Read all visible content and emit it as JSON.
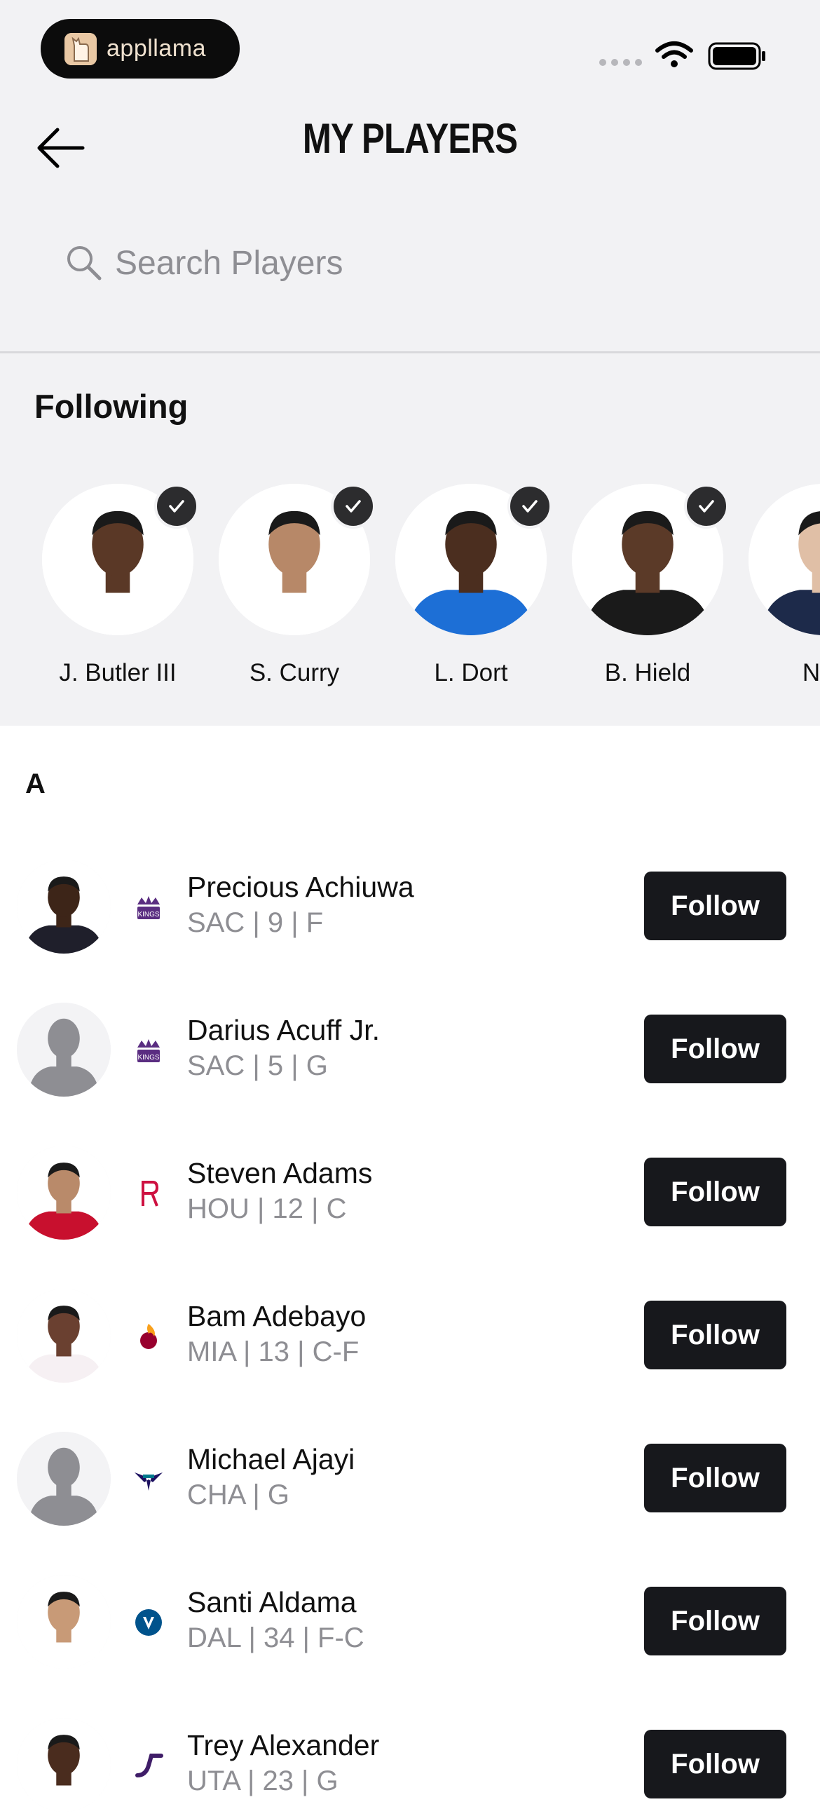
{
  "status_bar": {
    "app_badge": "appllama",
    "icons": [
      "signal-dots-icon",
      "wifi-icon",
      "battery-icon"
    ]
  },
  "header": {
    "back_icon": "arrow-left-icon",
    "title": "MY PLAYERS"
  },
  "search": {
    "placeholder": "Search Players",
    "value": ""
  },
  "following": {
    "label": "Following",
    "players": [
      {
        "name": "J. Butler III",
        "jersey": "#ffffff",
        "skin": "#5a3826",
        "followed": true
      },
      {
        "name": "S. Curry",
        "jersey": "#ffffff",
        "skin": "#b78868",
        "followed": true
      },
      {
        "name": "L. Dort",
        "jersey": "#1d6fd6",
        "skin": "#4b2e1f",
        "followed": true
      },
      {
        "name": "B. Hield",
        "jersey": "#1a1a1a",
        "skin": "#5b3a28",
        "followed": true
      },
      {
        "name": "N. J",
        "jersey": "#1d2a4a",
        "skin": "#e0bfa6",
        "followed": false
      }
    ]
  },
  "section_letter": "A",
  "players": [
    {
      "name": "Precious Achiuwa",
      "meta": "SAC | 9 | F",
      "team_icon": "kings-logo-icon",
      "team_color": "#5a2d81",
      "photo": "person",
      "jersey": "#1f1f2b",
      "skin": "#3d2518",
      "follow_label": "Follow"
    },
    {
      "name": "Darius Acuff Jr.",
      "meta": "SAC | 5 | G",
      "team_icon": "kings-logo-icon",
      "team_color": "#5a2d81",
      "photo": "placeholder",
      "jersey": "#8e8e93",
      "skin": "#8e8e93",
      "follow_label": "Follow"
    },
    {
      "name": "Steven Adams",
      "meta": "HOU | 12 | C",
      "team_icon": "rockets-logo-icon",
      "team_color": "#ce1141",
      "photo": "person",
      "jersey": "#c8102e",
      "skin": "#b98a6a",
      "follow_label": "Follow"
    },
    {
      "name": "Bam Adebayo",
      "meta": "MIA | 13 | C-F",
      "team_icon": "heat-logo-icon",
      "team_color": "#98002e",
      "photo": "person",
      "jersey": "#f6f0f3",
      "skin": "#6a4030",
      "follow_label": "Follow"
    },
    {
      "name": "Michael Ajayi",
      "meta": "CHA | G",
      "team_icon": "hornets-logo-icon",
      "team_color": "#1d1160",
      "photo": "placeholder",
      "jersey": "#8e8e93",
      "skin": "#8e8e93",
      "follow_label": "Follow"
    },
    {
      "name": "Santi Aldama",
      "meta": "DAL | 34 | F-C",
      "team_icon": "mavericks-logo-icon",
      "team_color": "#00538c",
      "photo": "person",
      "jersey": "#ffffff",
      "skin": "#c89a77",
      "follow_label": "Follow"
    },
    {
      "name": "Trey Alexander",
      "meta": "UTA | 23 | G",
      "team_icon": "jazz-logo-icon",
      "team_color": "#3f1d68",
      "photo": "person",
      "jersey": "#ffffff",
      "skin": "#4a2c1e",
      "follow_label": "Follow"
    }
  ]
}
